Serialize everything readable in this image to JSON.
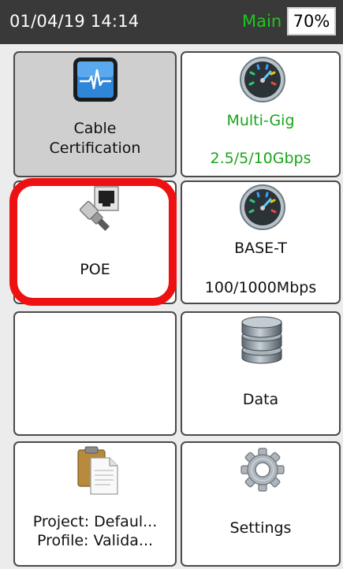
{
  "status": {
    "datetime": "01/04/19 14:14",
    "mode": "Main",
    "battery": "70%"
  },
  "tiles": {
    "cable_cert": {
      "line1": "Cable",
      "line2": "Certification",
      "icon": "oscilloscope-icon"
    },
    "multigig": {
      "title": "Multi-Gig",
      "speed": "2.5/5/10Gbps",
      "icon": "speedometer-icon"
    },
    "poe": {
      "title": "POE",
      "icon": "ethernet-plug-icon"
    },
    "baset": {
      "title": "BASE-T",
      "speed": "100/1000Mbps",
      "icon": "speedometer-icon"
    },
    "empty": {},
    "data": {
      "title": "Data",
      "icon": "database-icon"
    },
    "project": {
      "project": "Project: Defaul...",
      "profile": "Profile: Valida...",
      "icon": "clipboard-icon"
    },
    "settings": {
      "title": "Settings",
      "icon": "gear-icon"
    }
  },
  "colors": {
    "statusbar": "#393939",
    "mode_green": "#1ec81e",
    "speed_green": "#1aa51a",
    "highlight_red": "#ee1111",
    "selected_tile": "#cfcfcf"
  }
}
